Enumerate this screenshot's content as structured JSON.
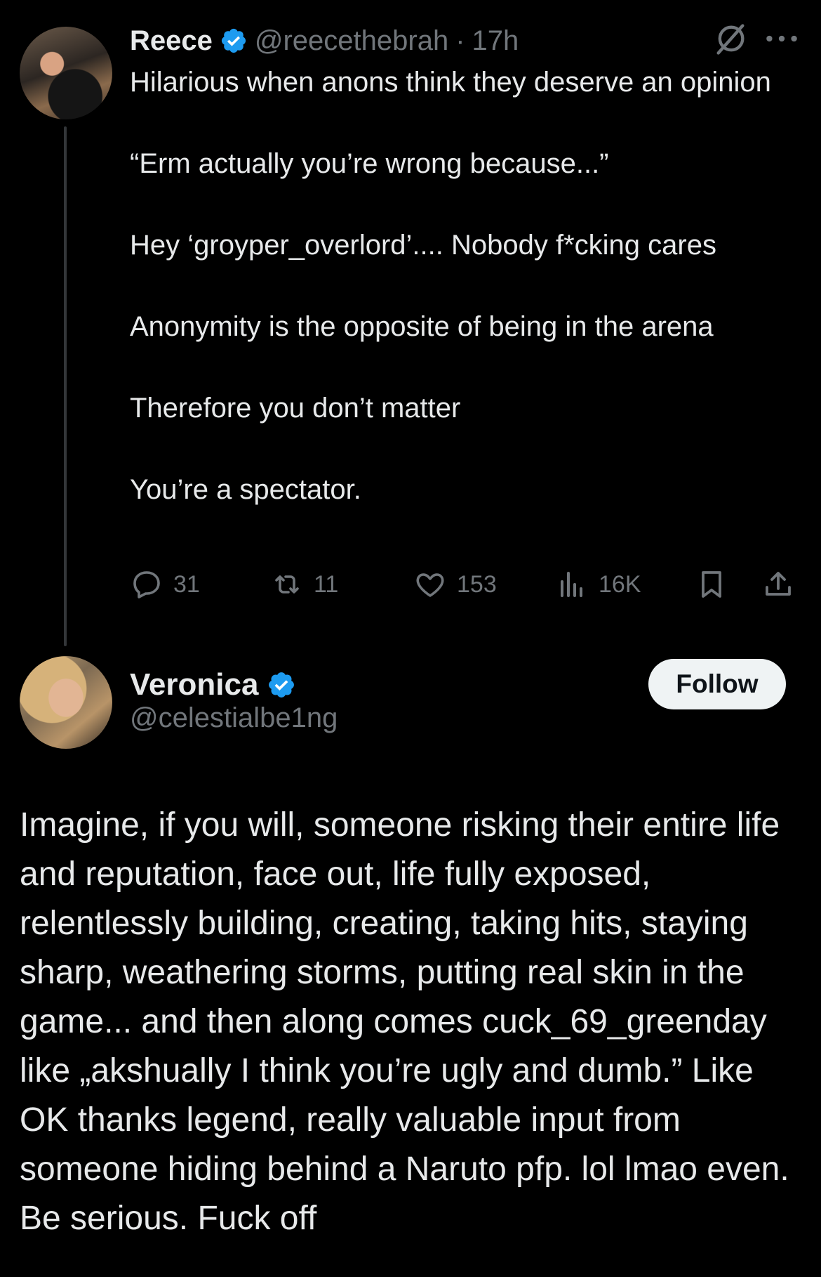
{
  "reply_tweet": {
    "author_name": "Reece",
    "author_handle": "@reecethebrah",
    "separator": "·",
    "time": "17h",
    "text_lines": [
      "Hilarious when anons think they deserve an opinion",
      "",
      "“Erm actually you’re wrong because...”",
      "",
      "Hey ‘groyper_overlord’.... Nobody f*cking cares",
      "",
      "Anonymity is the opposite of being in the arena",
      "",
      "Therefore you don’t matter",
      "",
      "You’re a spectator."
    ],
    "metrics": {
      "replies": "31",
      "reposts": "11",
      "likes": "153",
      "views": "16K"
    }
  },
  "main_tweet": {
    "author_name": "Veronica",
    "author_handle": "@celestialbe1ng",
    "follow_label": "Follow",
    "text": "Imagine, if you will, someone risking their entire life and reputation, face out, life fully exposed, relentlessly building, creating, taking hits, staying sharp, weathering storms, putting real skin in the game... and then along comes cuck_69_greenday like „akshually I think you’re ugly and dumb.” Like OK thanks legend, really valuable input from someone hiding behind a Naruto pfp. lol lmao even. Be serious. Fuck off"
  },
  "colors": {
    "background": "#000000",
    "text": "#e7e9ea",
    "secondary": "#71767b",
    "verified": "#1d9bf0",
    "follow_bg": "#eff3f4"
  },
  "icons": [
    "verified-badge-icon",
    "grok-icon",
    "more-icon",
    "reply-icon",
    "repost-icon",
    "like-icon",
    "views-icon",
    "bookmark-icon",
    "share-icon"
  ]
}
